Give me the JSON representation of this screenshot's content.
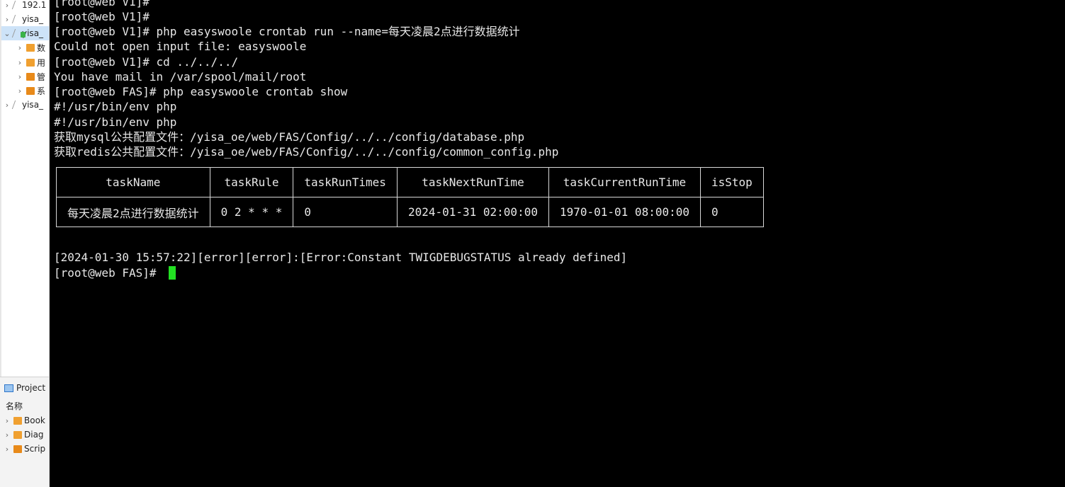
{
  "sidebar": {
    "tree": [
      {
        "label": "192.1",
        "expanded": false
      },
      {
        "label": "yisa_",
        "expanded": false
      },
      {
        "label": "yisa_",
        "expanded": true,
        "selected": true
      },
      {
        "label": "数",
        "child": true
      },
      {
        "label": "用",
        "child": true
      },
      {
        "label": "管",
        "child": true
      },
      {
        "label": "系",
        "child": true
      },
      {
        "label": "yisa_",
        "expanded": false
      }
    ],
    "project_panel": {
      "title": "Project",
      "column_header": "名称",
      "items": [
        "Book",
        "Diag",
        "Scrip"
      ]
    }
  },
  "terminal": {
    "lines": [
      "[root@web V1]#",
      "[root@web V1]#",
      "[root@web V1]# php easyswoole crontab run --name=每天凌晨2点进行数据统计",
      "Could not open input file: easyswoole",
      "[root@web V1]# cd ../../../",
      "You have mail in /var/spool/mail/root",
      "[root@web FAS]# php easyswoole crontab show",
      "#!/usr/bin/env php",
      "#!/usr/bin/env php",
      "获取mysql公共配置文件：/yisa_oe/web/FAS/Config/../../config/database.php",
      "获取redis公共配置文件：/yisa_oe/web/FAS/Config/../../config/common_config.php"
    ],
    "table": {
      "headers": [
        "taskName",
        "taskRule",
        "taskRunTimes",
        "taskNextRunTime",
        "taskCurrentRunTime",
        "isStop"
      ],
      "rows": [
        [
          "每天凌晨2点进行数据统计",
          "0 2 * * *",
          "0",
          "2024-01-31 02:00:00",
          "1970-01-01 08:00:00",
          "0"
        ]
      ]
    },
    "error_line": "[2024-01-30 15:57:22][error][error]:[Error:Constant TWIGDEBUGSTATUS already defined]",
    "prompt": "[root@web FAS]# ",
    "cursor_color": "#22e022"
  }
}
